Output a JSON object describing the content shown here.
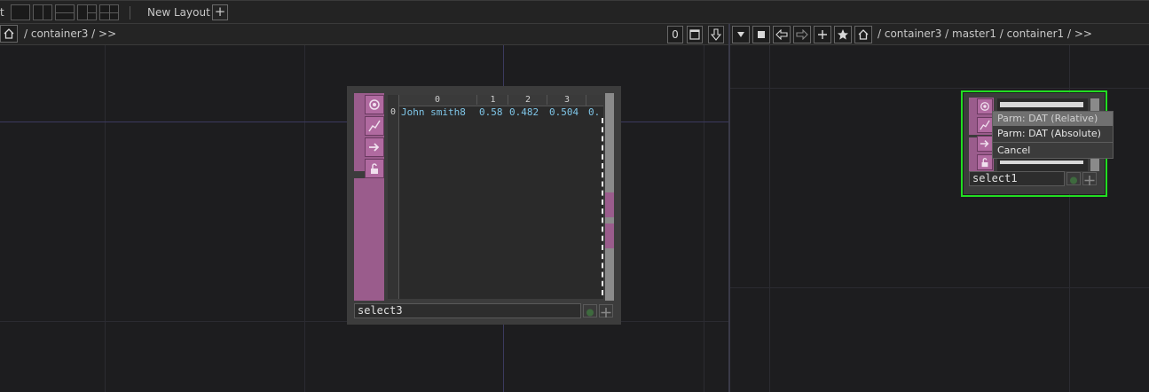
{
  "topbar": {
    "truncated_label": "t",
    "new_layout_label": "New Layout",
    "add_label": "+"
  },
  "left_pane": {
    "path": "/ container3 / >>",
    "toolbar_zero": "0"
  },
  "right_pane": {
    "path": "/ container3 / master1 / container1 / >>"
  },
  "node_select3": {
    "name": "select3",
    "table": {
      "col_headers": [
        "0",
        "1",
        "2",
        "3"
      ],
      "rows": [
        {
          "index": "0",
          "cells": [
            "John smith8",
            "0.58",
            "0.482",
            "0.504",
            "0."
          ]
        }
      ]
    }
  },
  "node_select1": {
    "name": "select1"
  },
  "context_menu": {
    "items": [
      "Parm: DAT (Relative)",
      "Parm: DAT (Absolute)",
      "Cancel"
    ]
  },
  "colors": {
    "selection_outline": "#22dd22",
    "node_pink": "#9a5c8c",
    "cell_text": "#7fc6e8"
  }
}
